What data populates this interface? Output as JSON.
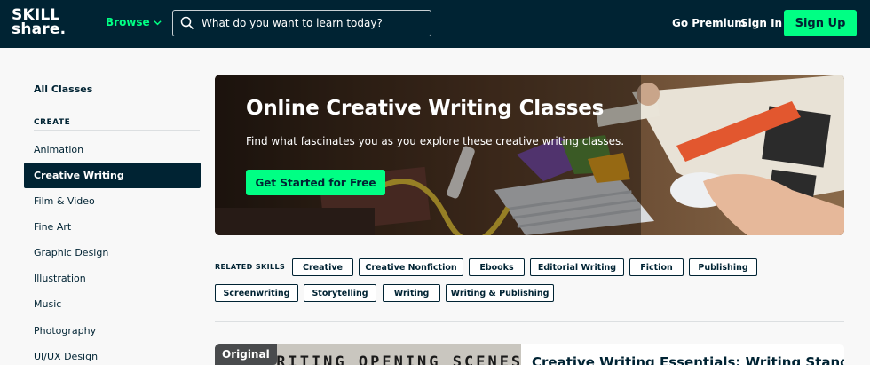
{
  "header": {
    "logo_line1": "SKILL",
    "logo_line2": "share.",
    "browse_label": "Browse",
    "search_placeholder": "What do you want to learn today?",
    "go_premium": "Go Premium",
    "sign_in": "Sign In",
    "sign_up": "Sign Up"
  },
  "sidebar": {
    "all_classes": "All Classes",
    "section_heading": "CREATE",
    "items": [
      {
        "label": "Animation"
      },
      {
        "label": "Creative Writing",
        "active": true
      },
      {
        "label": "Film & Video"
      },
      {
        "label": "Fine Art"
      },
      {
        "label": "Graphic Design"
      },
      {
        "label": "Illustration"
      },
      {
        "label": "Music"
      },
      {
        "label": "Photography"
      },
      {
        "label": "UI/UX Design"
      }
    ]
  },
  "hero": {
    "title": "Online Creative Writing Classes",
    "subtitle": "Find what fascinates you as you explore these creative writing classes.",
    "cta": "Get Started for Free"
  },
  "related": {
    "label": "RELATED SKILLS",
    "chips": [
      "Creative",
      "Creative Nonfiction",
      "Ebooks",
      "Editorial Writing",
      "Fiction",
      "Publishing",
      "Screenwriting",
      "Storytelling",
      "Writing",
      "Writing & Publishing"
    ]
  },
  "card": {
    "badge": "Original",
    "thumb_text": "WRITING OPENING SCENES",
    "title": "Creative Writing Essentials: Writing Stand-"
  },
  "colors": {
    "navy": "#002333",
    "accent_green": "#00ff84"
  }
}
